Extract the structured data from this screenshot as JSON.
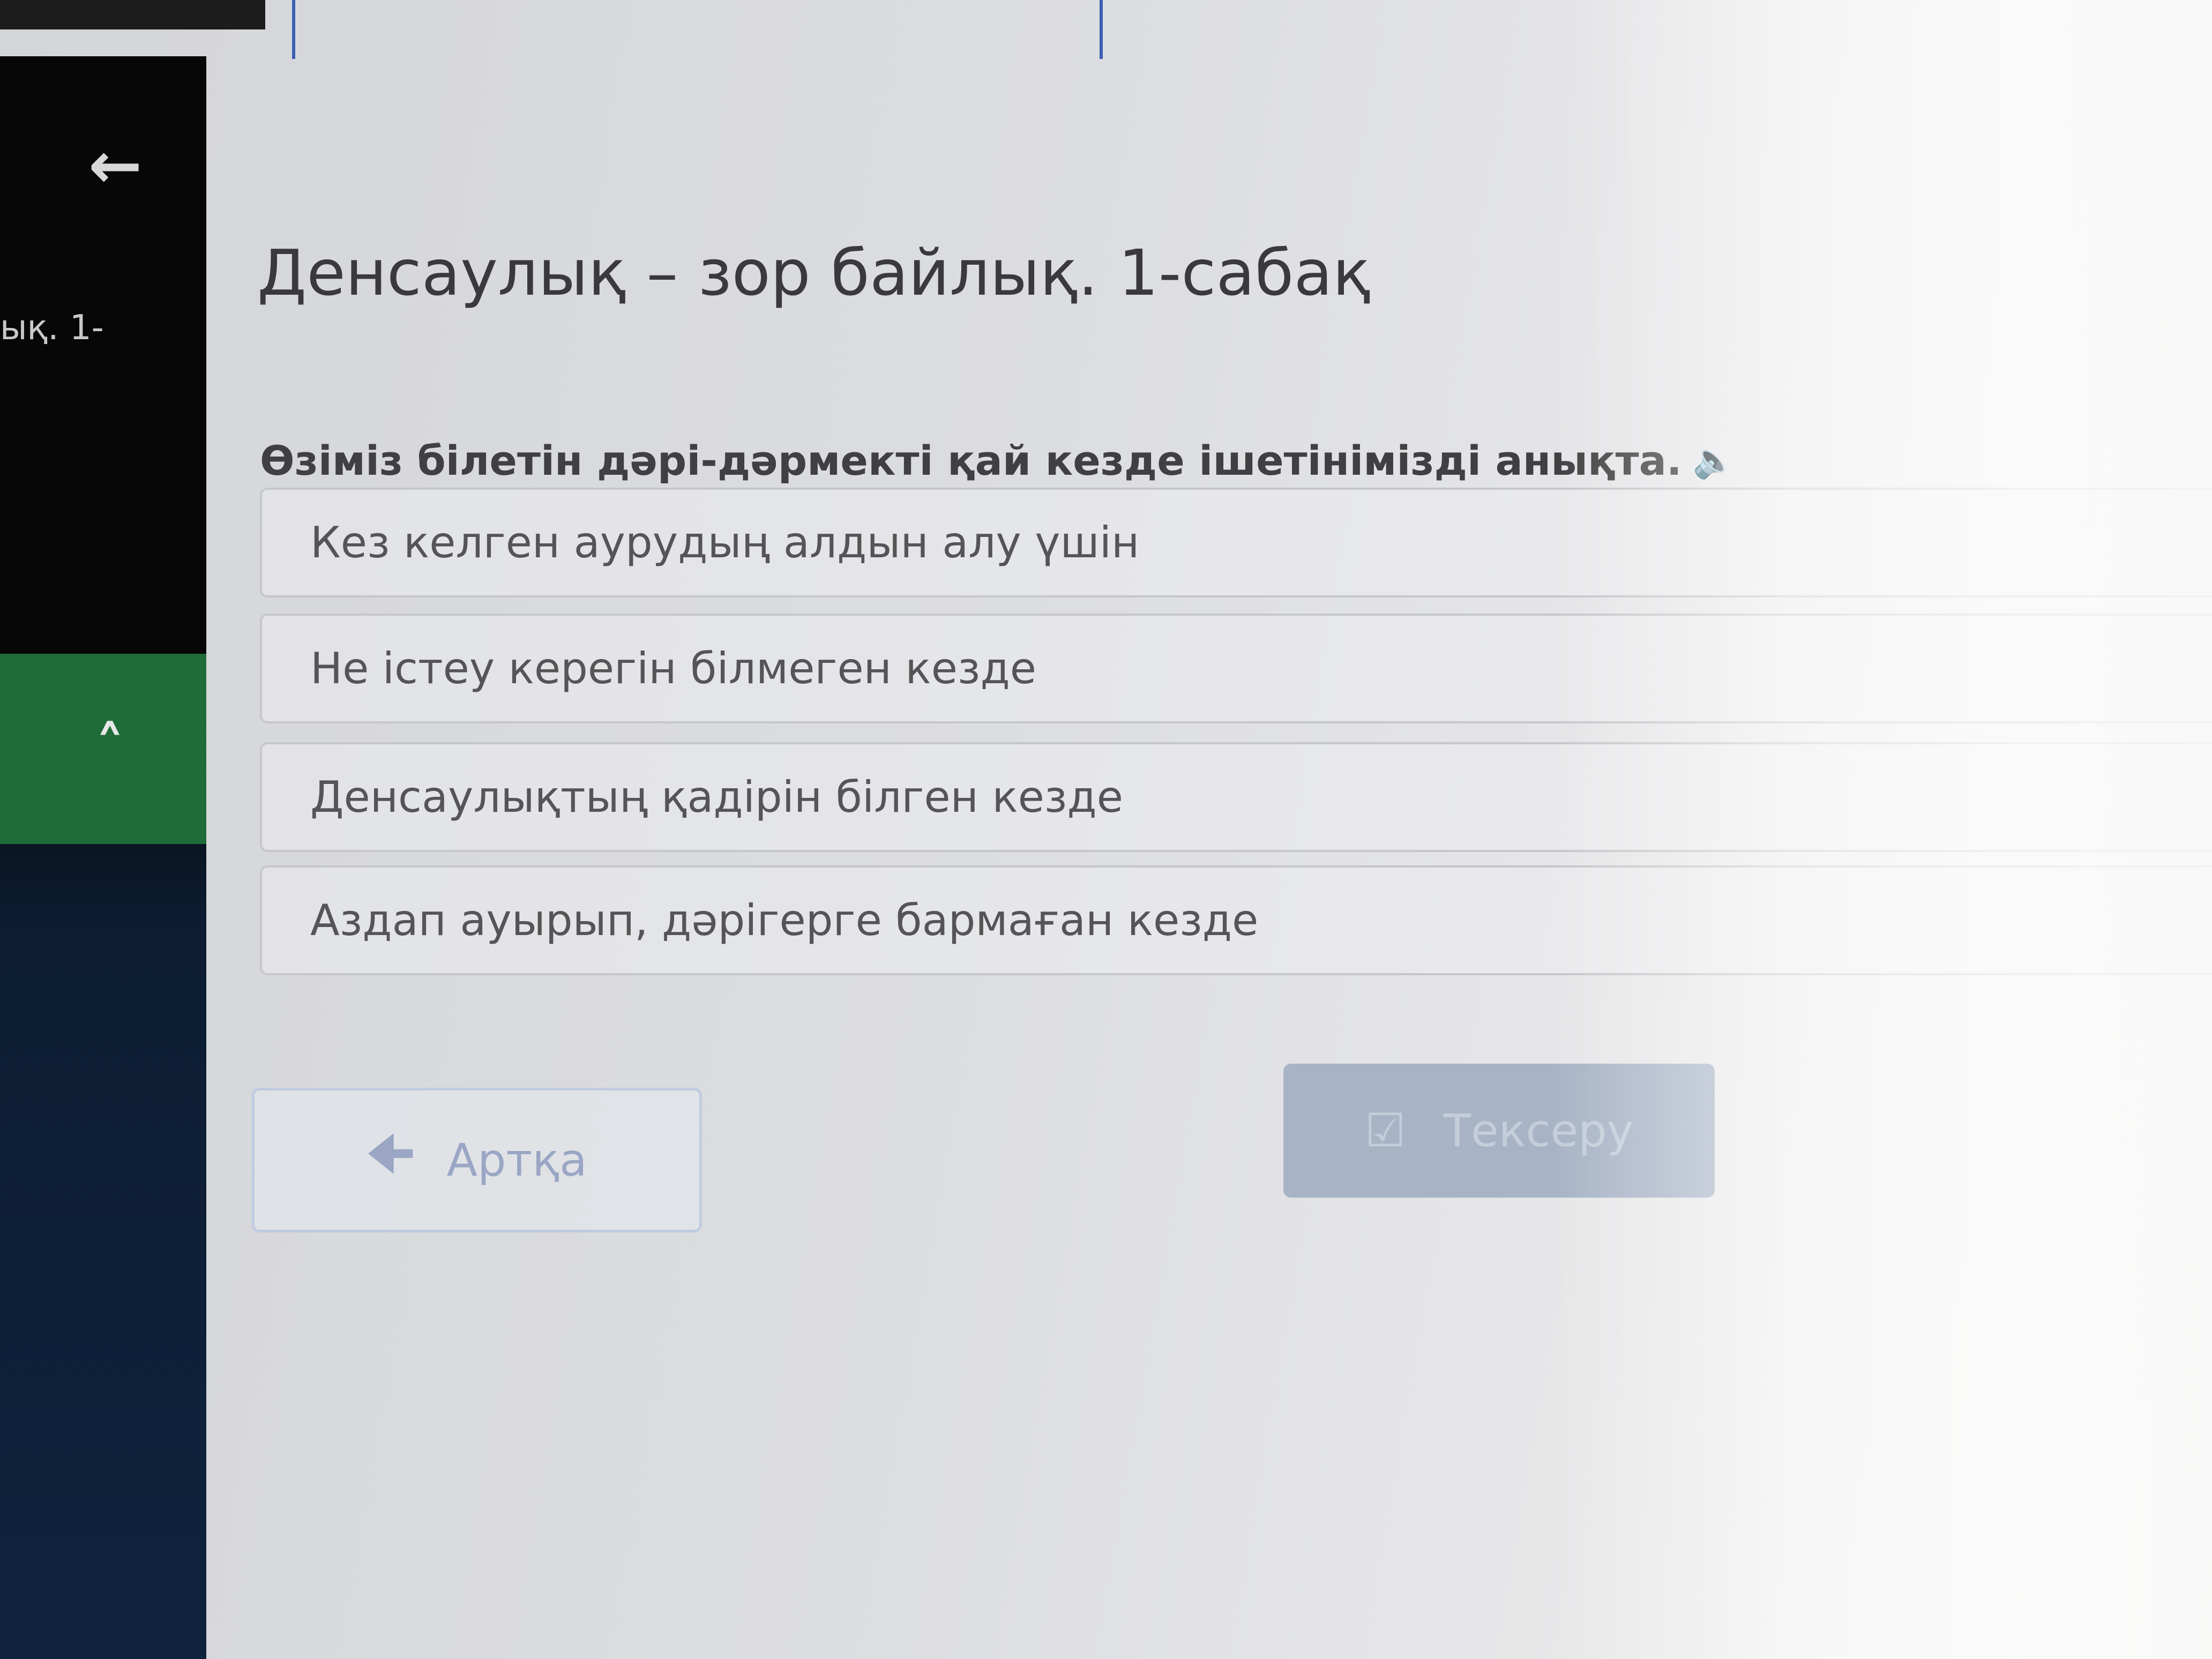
{
  "sidebar": {
    "back_icon": "arrow-left-icon",
    "course_label": "ық. 1-",
    "collapse_icon": "chevron-up-icon"
  },
  "lesson": {
    "title": "Денсаулық – зор байлық. 1-сабақ"
  },
  "question": {
    "text": "Өзіміз білетін дәрі-дәрмекті қай кезде ішетінімізді анықта.",
    "audio_icon": "speaker-icon",
    "options": [
      "Кез келген аурудың алдын алу үшін",
      "Не істеу керегін білмеген кезде",
      "Денсаулықтың қадірін білген кезде",
      "Аздап ауырып, дәрігерге бармаған кезде"
    ]
  },
  "buttons": {
    "back_label": "Артқа",
    "check_label": "Тексеру"
  },
  "colors": {
    "sidebar_dark": "#070707",
    "sidebar_navy": "#10233d",
    "sidebar_green": "#1f6c38",
    "check_button": "#a8b4c6",
    "back_button_border": "#bfcbe0"
  }
}
